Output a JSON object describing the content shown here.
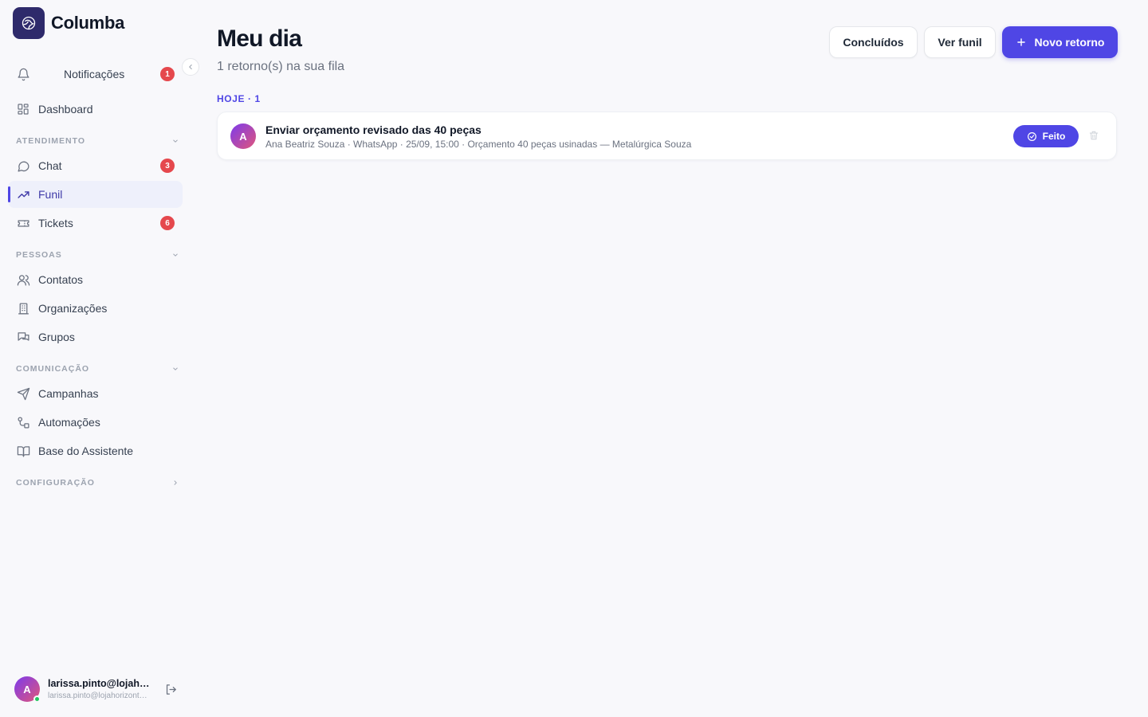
{
  "brand": {
    "name": "Columba"
  },
  "sidebar": {
    "notifications": {
      "label": "Notificações",
      "badge": "1"
    },
    "dashboard": {
      "label": "Dashboard"
    },
    "sections": {
      "atendimento": "ATENDIMENTO",
      "pessoas": "PESSOAS",
      "comunicacao": "COMUNICAÇÃO",
      "configuracao": "CONFIGURAÇÃO"
    },
    "items": {
      "chat": {
        "label": "Chat",
        "badge": "3"
      },
      "funil": {
        "label": "Funil"
      },
      "tickets": {
        "label": "Tickets",
        "badge": "6"
      },
      "contatos": {
        "label": "Contatos"
      },
      "organizacoes": {
        "label": "Organizações"
      },
      "grupos": {
        "label": "Grupos"
      },
      "campanhas": {
        "label": "Campanhas"
      },
      "automacoes": {
        "label": "Automações"
      },
      "base": {
        "label": "Base do Assistente"
      }
    },
    "user": {
      "initial": "A",
      "name": "larissa.pinto@lojahorizonte.com.br",
      "email": "larissa.pinto@lojahorizonte.com.br"
    }
  },
  "main": {
    "title": "Meu dia",
    "subtitle": "1 retorno(s) na sua fila",
    "buttons": {
      "concluidos": "Concluídos",
      "ver_funil": "Ver funil",
      "novo_retorno": "Novo retorno"
    },
    "day_label": "HOJE · 1",
    "tasks": [
      {
        "initial": "A",
        "title": "Enviar orçamento revisado das 40 peças",
        "meta": "Ana Beatriz Souza · WhatsApp · 25/09, 15:00 · Orçamento 40 peças usinadas — Metalúrgica Souza",
        "done_label": "Feito"
      }
    ]
  },
  "colors": {
    "accent": "#4f46e5",
    "badge": "#e5484d",
    "active_bg": "#eef0fb",
    "brand_logo": "#2e2a6b"
  }
}
